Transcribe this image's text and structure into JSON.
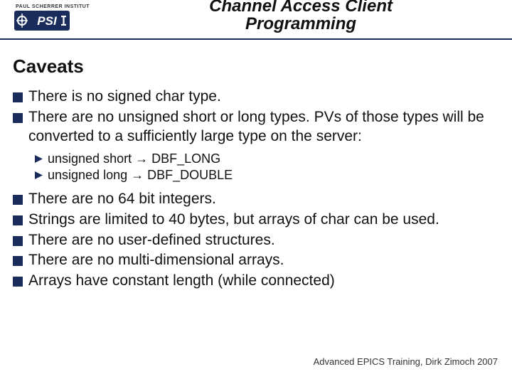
{
  "header": {
    "tagline": "PAUL SCHERRER INSTITUT",
    "logo_text": "PSI",
    "title_line1": "Channel Access Client",
    "title_line2": "Programming"
  },
  "section_title": "Caveats",
  "bullets": {
    "b0": "There is no signed char type.",
    "b1": "There are no unsigned short or long types. PVs of those types will be converted to a sufficiently large type on the server:",
    "b2": "There are no 64 bit integers.",
    "b3": "Strings are limited to 40 bytes, but arrays of char can be used.",
    "b4": "There are no user-defined structures.",
    "b5": "There are no multi-dimensional arrays.",
    "b6": "Arrays have constant length (while connected)"
  },
  "sub": {
    "s0": "unsigned short → DBF_LONG",
    "s1": "unsigned long → DBF_DOUBLE"
  },
  "footer": "Advanced EPICS Training, Dirk Zimoch 2007"
}
